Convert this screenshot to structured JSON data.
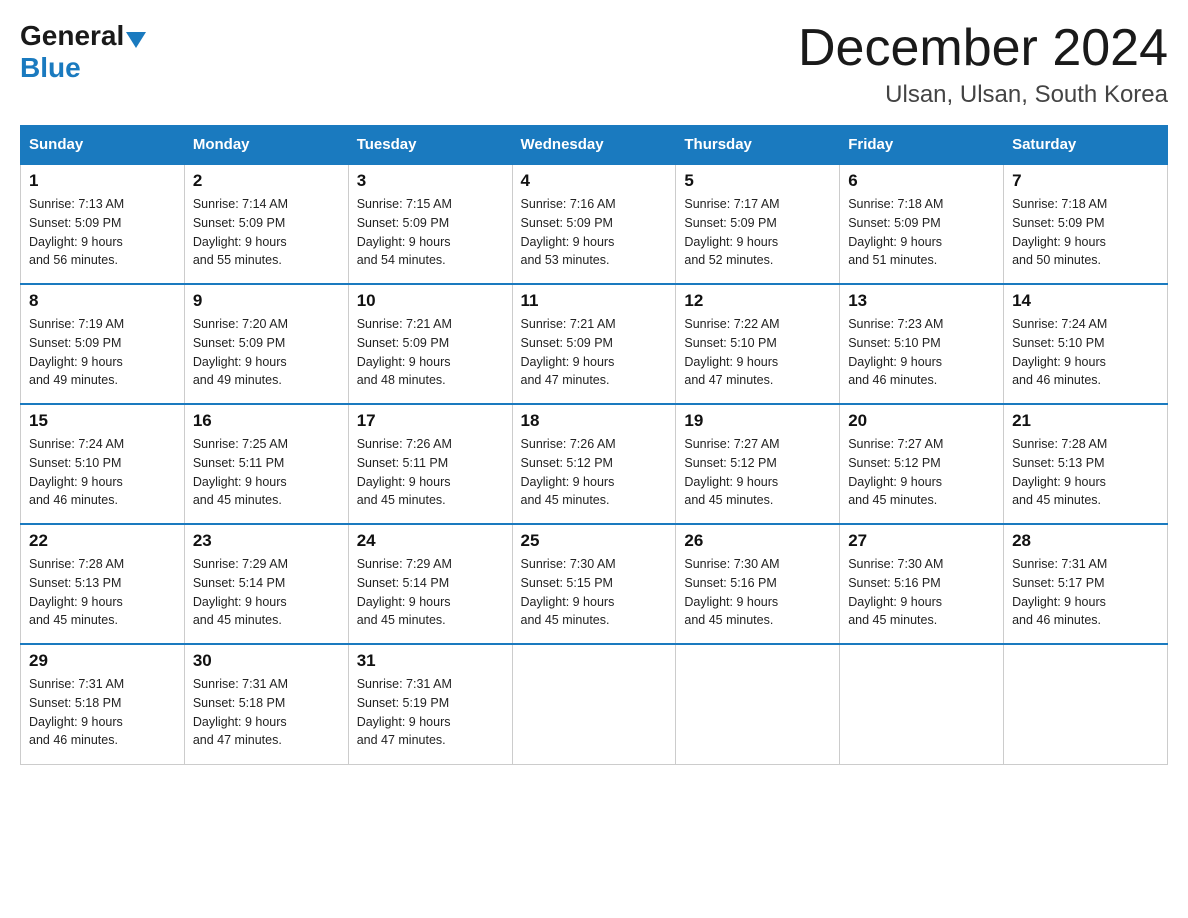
{
  "logo": {
    "general": "General",
    "blue": "Blue"
  },
  "header": {
    "month_year": "December 2024",
    "location": "Ulsan, Ulsan, South Korea"
  },
  "columns": [
    "Sunday",
    "Monday",
    "Tuesday",
    "Wednesday",
    "Thursday",
    "Friday",
    "Saturday"
  ],
  "weeks": [
    [
      {
        "day": "1",
        "sunrise": "7:13 AM",
        "sunset": "5:09 PM",
        "daylight": "9 hours and 56 minutes."
      },
      {
        "day": "2",
        "sunrise": "7:14 AM",
        "sunset": "5:09 PM",
        "daylight": "9 hours and 55 minutes."
      },
      {
        "day": "3",
        "sunrise": "7:15 AM",
        "sunset": "5:09 PM",
        "daylight": "9 hours and 54 minutes."
      },
      {
        "day": "4",
        "sunrise": "7:16 AM",
        "sunset": "5:09 PM",
        "daylight": "9 hours and 53 minutes."
      },
      {
        "day": "5",
        "sunrise": "7:17 AM",
        "sunset": "5:09 PM",
        "daylight": "9 hours and 52 minutes."
      },
      {
        "day": "6",
        "sunrise": "7:18 AM",
        "sunset": "5:09 PM",
        "daylight": "9 hours and 51 minutes."
      },
      {
        "day": "7",
        "sunrise": "7:18 AM",
        "sunset": "5:09 PM",
        "daylight": "9 hours and 50 minutes."
      }
    ],
    [
      {
        "day": "8",
        "sunrise": "7:19 AM",
        "sunset": "5:09 PM",
        "daylight": "9 hours and 49 minutes."
      },
      {
        "day": "9",
        "sunrise": "7:20 AM",
        "sunset": "5:09 PM",
        "daylight": "9 hours and 49 minutes."
      },
      {
        "day": "10",
        "sunrise": "7:21 AM",
        "sunset": "5:09 PM",
        "daylight": "9 hours and 48 minutes."
      },
      {
        "day": "11",
        "sunrise": "7:21 AM",
        "sunset": "5:09 PM",
        "daylight": "9 hours and 47 minutes."
      },
      {
        "day": "12",
        "sunrise": "7:22 AM",
        "sunset": "5:10 PM",
        "daylight": "9 hours and 47 minutes."
      },
      {
        "day": "13",
        "sunrise": "7:23 AM",
        "sunset": "5:10 PM",
        "daylight": "9 hours and 46 minutes."
      },
      {
        "day": "14",
        "sunrise": "7:24 AM",
        "sunset": "5:10 PM",
        "daylight": "9 hours and 46 minutes."
      }
    ],
    [
      {
        "day": "15",
        "sunrise": "7:24 AM",
        "sunset": "5:10 PM",
        "daylight": "9 hours and 46 minutes."
      },
      {
        "day": "16",
        "sunrise": "7:25 AM",
        "sunset": "5:11 PM",
        "daylight": "9 hours and 45 minutes."
      },
      {
        "day": "17",
        "sunrise": "7:26 AM",
        "sunset": "5:11 PM",
        "daylight": "9 hours and 45 minutes."
      },
      {
        "day": "18",
        "sunrise": "7:26 AM",
        "sunset": "5:12 PM",
        "daylight": "9 hours and 45 minutes."
      },
      {
        "day": "19",
        "sunrise": "7:27 AM",
        "sunset": "5:12 PM",
        "daylight": "9 hours and 45 minutes."
      },
      {
        "day": "20",
        "sunrise": "7:27 AM",
        "sunset": "5:12 PM",
        "daylight": "9 hours and 45 minutes."
      },
      {
        "day": "21",
        "sunrise": "7:28 AM",
        "sunset": "5:13 PM",
        "daylight": "9 hours and 45 minutes."
      }
    ],
    [
      {
        "day": "22",
        "sunrise": "7:28 AM",
        "sunset": "5:13 PM",
        "daylight": "9 hours and 45 minutes."
      },
      {
        "day": "23",
        "sunrise": "7:29 AM",
        "sunset": "5:14 PM",
        "daylight": "9 hours and 45 minutes."
      },
      {
        "day": "24",
        "sunrise": "7:29 AM",
        "sunset": "5:14 PM",
        "daylight": "9 hours and 45 minutes."
      },
      {
        "day": "25",
        "sunrise": "7:30 AM",
        "sunset": "5:15 PM",
        "daylight": "9 hours and 45 minutes."
      },
      {
        "day": "26",
        "sunrise": "7:30 AM",
        "sunset": "5:16 PM",
        "daylight": "9 hours and 45 minutes."
      },
      {
        "day": "27",
        "sunrise": "7:30 AM",
        "sunset": "5:16 PM",
        "daylight": "9 hours and 45 minutes."
      },
      {
        "day": "28",
        "sunrise": "7:31 AM",
        "sunset": "5:17 PM",
        "daylight": "9 hours and 46 minutes."
      }
    ],
    [
      {
        "day": "29",
        "sunrise": "7:31 AM",
        "sunset": "5:18 PM",
        "daylight": "9 hours and 46 minutes."
      },
      {
        "day": "30",
        "sunrise": "7:31 AM",
        "sunset": "5:18 PM",
        "daylight": "9 hours and 47 minutes."
      },
      {
        "day": "31",
        "sunrise": "7:31 AM",
        "sunset": "5:19 PM",
        "daylight": "9 hours and 47 minutes."
      },
      null,
      null,
      null,
      null
    ]
  ],
  "labels": {
    "sunrise": "Sunrise:",
    "sunset": "Sunset:",
    "daylight": "Daylight:"
  }
}
